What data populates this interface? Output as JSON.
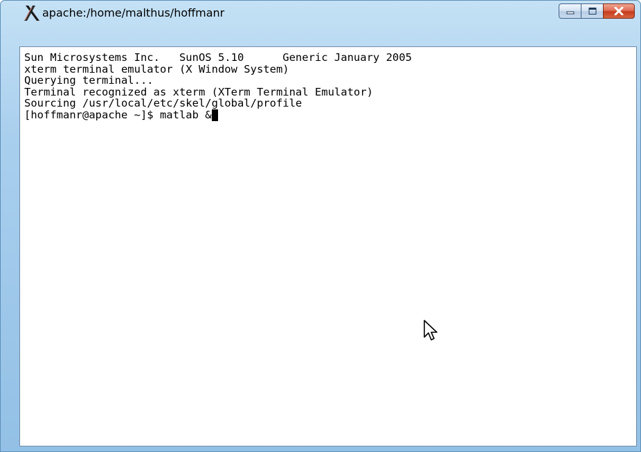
{
  "window": {
    "title": "apache:/home/malthus/hoffmanr",
    "app_icon": "x-window-system-icon",
    "controls": {
      "minimize_icon": "minimize-icon",
      "maximize_icon": "maximize-icon",
      "close_icon": "close-icon"
    }
  },
  "terminal": {
    "lines": [
      "Sun Microsystems Inc.   SunOS 5.10      Generic January 2005",
      "xterm terminal emulator (X Window System)",
      "Querying terminal...",
      "Terminal recognized as xterm (XTerm Terminal Emulator)",
      "Sourcing /usr/local/etc/skel/global/profile"
    ],
    "prompt": "[hoffmanr@apache ~]$ ",
    "command": "matlab &"
  },
  "colors": {
    "frame": "#a9cfee",
    "terminal_background": "#ffffff",
    "terminal_text": "#000000",
    "close_button": "#c43c1c"
  },
  "icons": {
    "mouse_pointer": "arrow-pointer-icon"
  }
}
